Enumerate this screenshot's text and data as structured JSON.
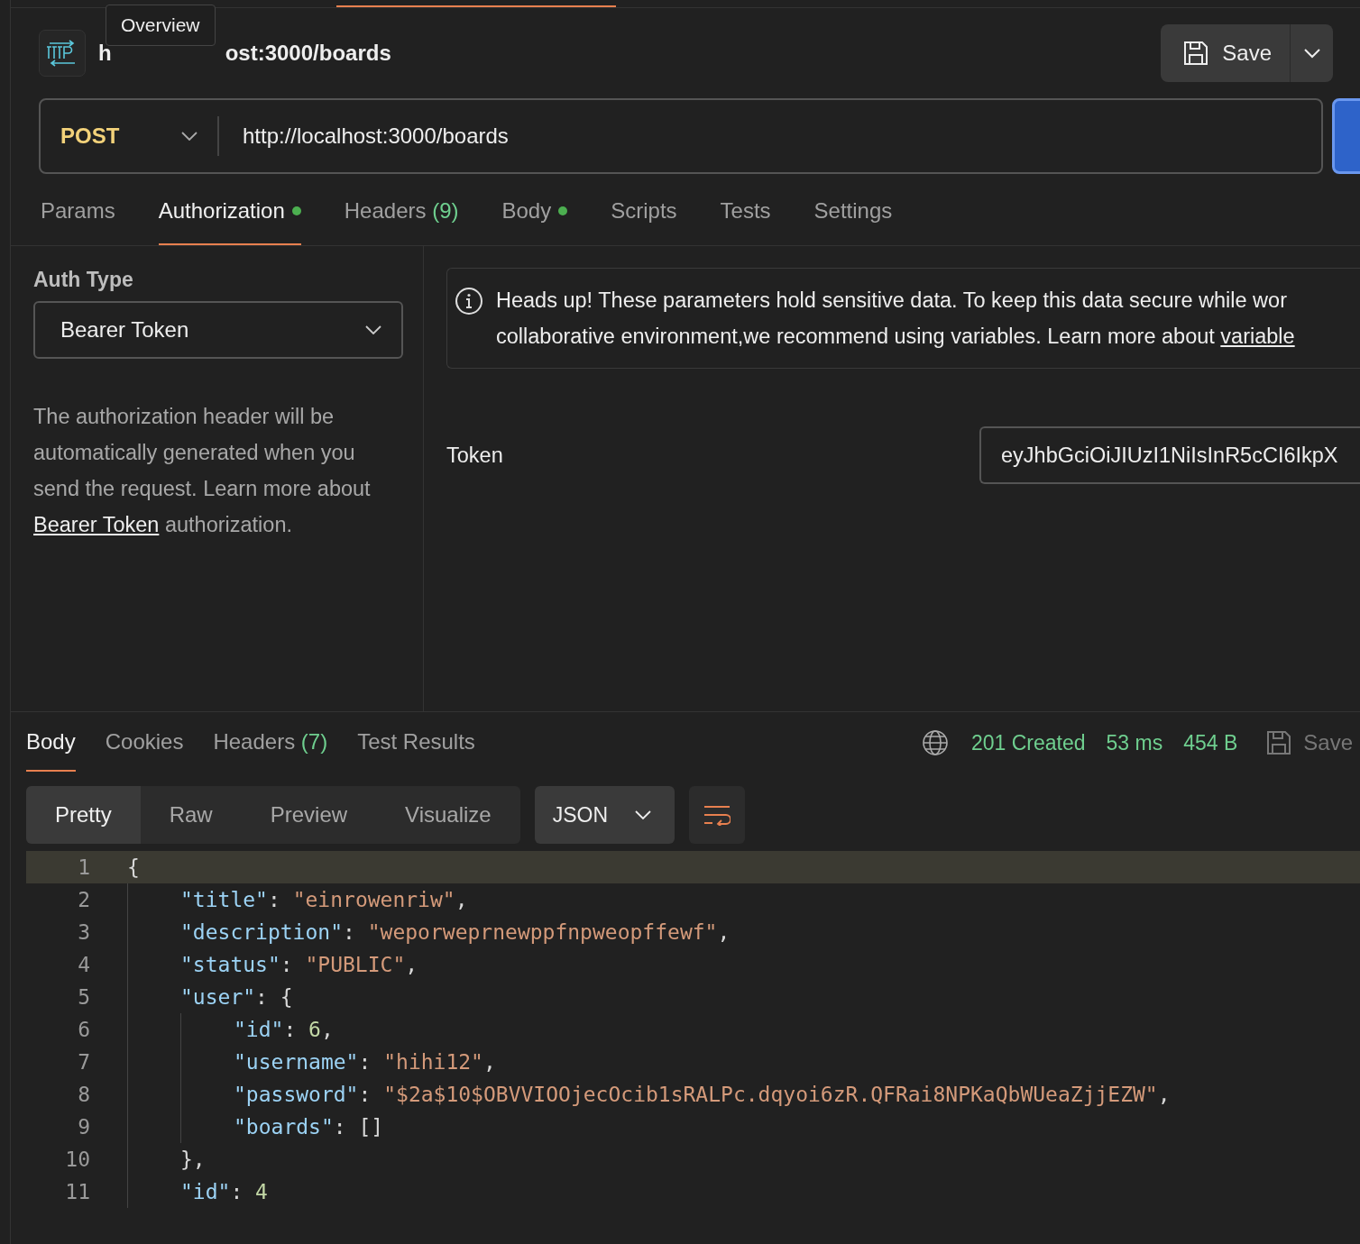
{
  "tooltip": "Overview",
  "request": {
    "title_parts": [
      "h",
      "ost:3000/boards"
    ],
    "method": "POST",
    "url": "http://localhost:3000/boards"
  },
  "save_button": {
    "label": "Save"
  },
  "request_tabs": [
    {
      "label": "Params",
      "dot": false,
      "selected": false
    },
    {
      "label": "Authorization",
      "dot": true,
      "selected": true
    },
    {
      "label": "Headers",
      "count": "(9)",
      "dot": false,
      "selected": false
    },
    {
      "label": "Body",
      "dot": true,
      "selected": false
    },
    {
      "label": "Scripts",
      "dot": false,
      "selected": false
    },
    {
      "label": "Tests",
      "dot": false,
      "selected": false
    },
    {
      "label": "Settings",
      "dot": false,
      "selected": false
    }
  ],
  "auth": {
    "heading": "Auth Type",
    "type": "Bearer Token",
    "help_before": "The authorization header will be automatically generated when you send the request. Learn more about ",
    "help_link": "Bearer Token",
    "help_after": " authorization.",
    "notice_line1": "Heads up! These parameters hold sensitive data. To keep this data secure while wor",
    "notice_line2": "collaborative environment,we recommend using variables. Learn more about ",
    "notice_link": "variable",
    "token_label": "Token",
    "token_value": "eyJhbGciOiJIUzI1NiIsInR5cCI6IkpX"
  },
  "response_tabs": [
    {
      "label": "Body",
      "selected": true
    },
    {
      "label": "Cookies",
      "selected": false
    },
    {
      "label": "Headers",
      "count": "(7)",
      "selected": false
    },
    {
      "label": "Test Results",
      "selected": false
    }
  ],
  "status": {
    "code": "201 Created",
    "time": "53 ms",
    "size": "454 B",
    "save_label": "Save"
  },
  "view_modes": [
    {
      "label": "Pretty",
      "selected": true
    },
    {
      "label": "Raw",
      "selected": false
    },
    {
      "label": "Preview",
      "selected": false
    },
    {
      "label": "Visualize",
      "selected": false
    }
  ],
  "format": "JSON",
  "code_lines": [
    {
      "number": "1",
      "current": true,
      "tokens": [
        {
          "kind": "punct",
          "text": "{"
        }
      ],
      "children": [
        {
          "number": "2",
          "current": false,
          "tokens": [
            {
              "kind": "key",
              "text": "\"title\""
            },
            {
              "kind": "punct",
              "text": ": "
            },
            {
              "kind": "str",
              "text": "\"einrowenriw\""
            },
            {
              "kind": "punct",
              "text": ","
            }
          ]
        },
        {
          "number": "3",
          "current": false,
          "tokens": [
            {
              "kind": "key",
              "text": "\"description\""
            },
            {
              "kind": "punct",
              "text": ": "
            },
            {
              "kind": "str",
              "text": "\"weporweprnewppfnpweopffewf\""
            },
            {
              "kind": "punct",
              "text": ","
            }
          ]
        },
        {
          "number": "4",
          "current": false,
          "tokens": [
            {
              "kind": "key",
              "text": "\"status\""
            },
            {
              "kind": "punct",
              "text": ": "
            },
            {
              "kind": "str",
              "text": "\"PUBLIC\""
            },
            {
              "kind": "punct",
              "text": ","
            }
          ]
        },
        {
          "number": "5",
          "current": false,
          "tokens": [
            {
              "kind": "key",
              "text": "\"user\""
            },
            {
              "kind": "punct",
              "text": ": {"
            }
          ],
          "children": [
            {
              "number": "6",
              "current": false,
              "tokens": [
                {
                  "kind": "key",
                  "text": "\"id\""
                },
                {
                  "kind": "punct",
                  "text": ": "
                },
                {
                  "kind": "num",
                  "text": "6"
                },
                {
                  "kind": "punct",
                  "text": ","
                }
              ]
            },
            {
              "number": "7",
              "current": false,
              "tokens": [
                {
                  "kind": "key",
                  "text": "\"username\""
                },
                {
                  "kind": "punct",
                  "text": ": "
                },
                {
                  "kind": "str",
                  "text": "\"hihi12\""
                },
                {
                  "kind": "punct",
                  "text": ","
                }
              ]
            },
            {
              "number": "8",
              "current": false,
              "tokens": [
                {
                  "kind": "key",
                  "text": "\"password\""
                },
                {
                  "kind": "punct",
                  "text": ": "
                },
                {
                  "kind": "str",
                  "text": "\"$2a$10$OBVVIOOjecOcib1sRALPc.dqyoi6zR.QFRai8NPKaQbWUeaZjjEZW\""
                },
                {
                  "kind": "punct",
                  "text": ","
                }
              ]
            },
            {
              "number": "9",
              "current": false,
              "tokens": [
                {
                  "kind": "key",
                  "text": "\"boards\""
                },
                {
                  "kind": "punct",
                  "text": ": []"
                }
              ]
            }
          ]
        },
        {
          "number": "10",
          "current": false,
          "tokens": [
            {
              "kind": "punct",
              "text": "},"
            }
          ]
        },
        {
          "number": "11",
          "current": false,
          "tokens": [
            {
              "kind": "key",
              "text": "\"id\""
            },
            {
              "kind": "punct",
              "text": ": "
            },
            {
              "kind": "num",
              "text": "4"
            }
          ]
        }
      ]
    }
  ]
}
